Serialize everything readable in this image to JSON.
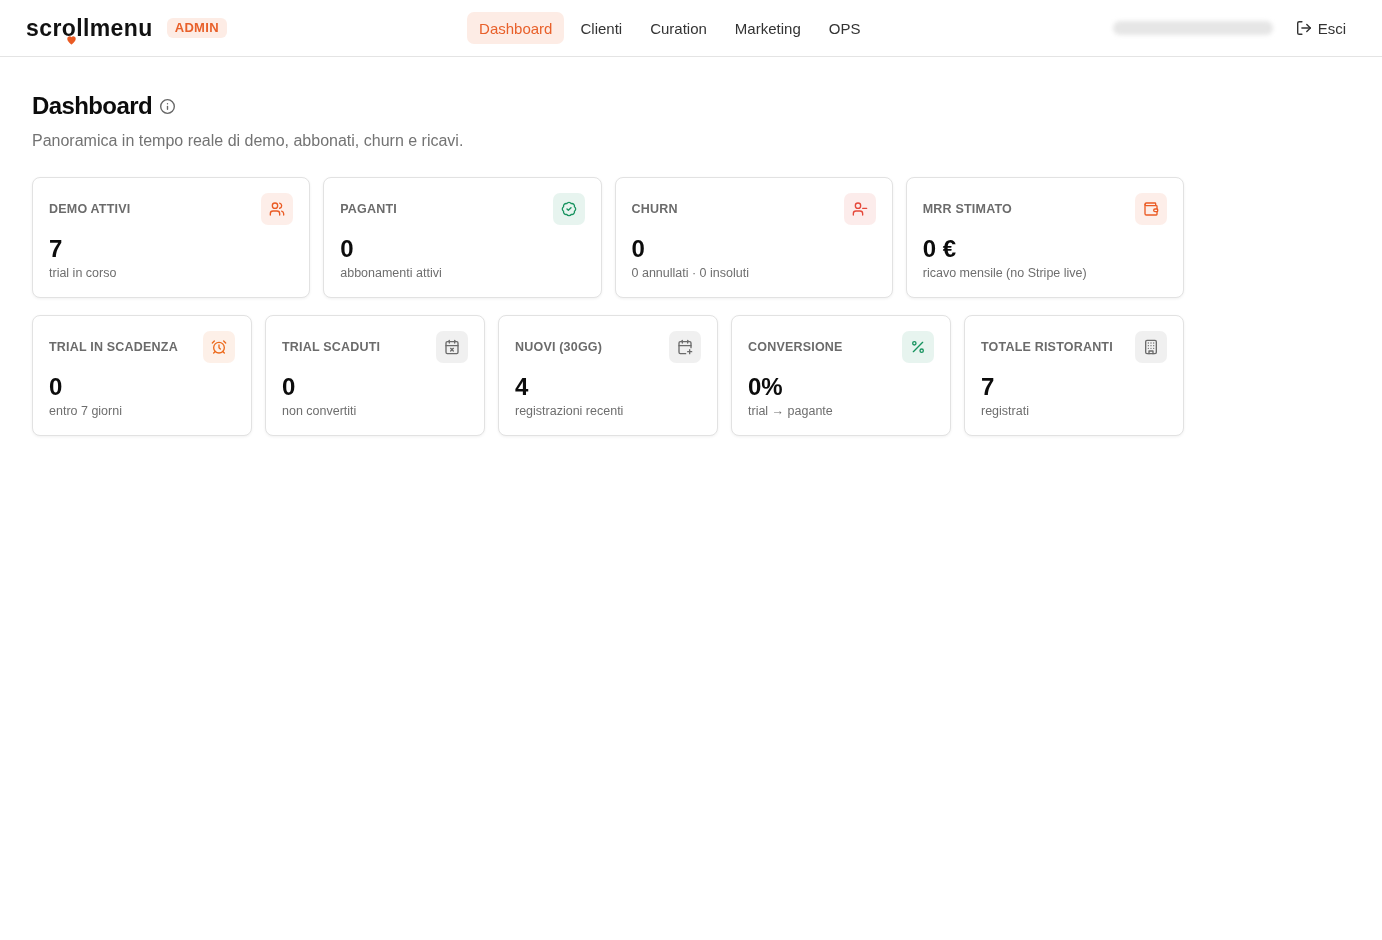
{
  "header": {
    "logo": "scrollmenu",
    "role_badge": "ADMIN",
    "nav": [
      {
        "label": "Dashboard",
        "selected": true
      },
      {
        "label": "Clienti",
        "selected": false
      },
      {
        "label": "Curation",
        "selected": false
      },
      {
        "label": "Marketing",
        "selected": false
      },
      {
        "label": "OPS",
        "selected": false
      }
    ],
    "logout": "Esci"
  },
  "page": {
    "title": "Dashboard",
    "subtitle": "Panoramica in tempo reale di demo, abbonati, churn e ricavi."
  },
  "stat_rows": [
    {
      "cards": [
        {
          "label": "DEMO ATTIVI",
          "value": "7",
          "caption": "trial in corso",
          "color": "#ea5b24"
        },
        {
          "label": "PAGANTI",
          "value": "0",
          "caption": "abbonamenti attivi",
          "color": "#17935f"
        },
        {
          "label": "CHURN",
          "value": "0",
          "caption": "0 annullati · 0 insoluti",
          "color": "#e5483a"
        },
        {
          "label": "MRR STIMATO",
          "value": "0 €",
          "caption": "ricavo mensile (no Stripe live)",
          "color": "#ea5b24"
        }
      ]
    },
    {
      "cards": [
        {
          "label": "TRIAL IN SCADENZA",
          "value": "0",
          "caption": "entro 7 giorni",
          "color": "#ec6a1c"
        },
        {
          "label": "TRIAL SCADUTI",
          "value": "0",
          "caption": "non convertiti",
          "color": "#6b6b6b"
        },
        {
          "label": "NUOVI (30GG)",
          "value": "4",
          "caption": "registrazioni recenti",
          "color": "#6b6b6b"
        },
        {
          "label": "CONVERSIONE",
          "value": "0%",
          "caption": "trial → pagante",
          "color": "#17935f"
        },
        {
          "label": "TOTALE RISTORANTI",
          "value": "7",
          "caption": "registrati",
          "color": "#6b6b6b"
        }
      ]
    }
  ]
}
